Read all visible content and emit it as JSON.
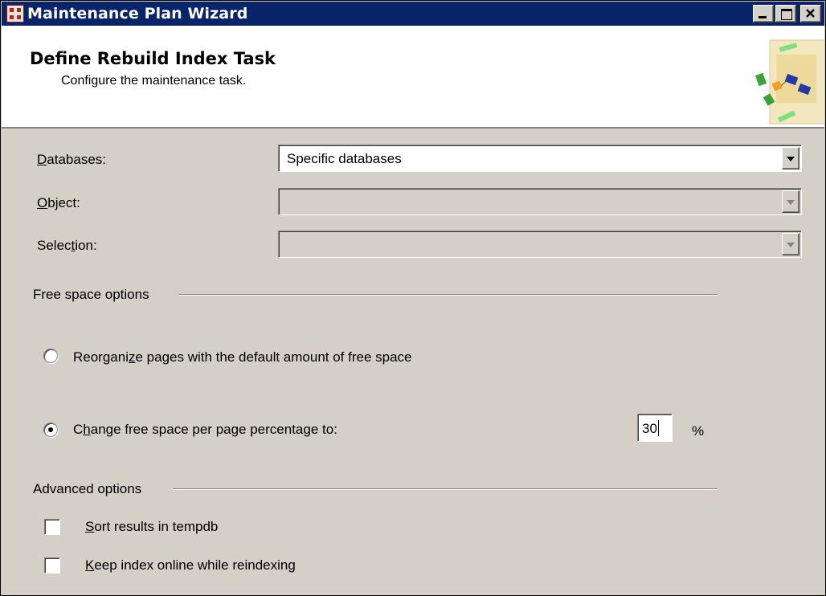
{
  "window": {
    "title": "Maintenance Plan Wizard"
  },
  "header": {
    "title": "Define Rebuild Index Task",
    "subtitle": "Configure the maintenance task."
  },
  "form": {
    "databases": {
      "label_access": "D",
      "label_rest": "atabases:",
      "value": "Specific databases"
    },
    "object": {
      "label_access": "O",
      "label_rest": "bject:",
      "value": ""
    },
    "selection": {
      "label_pre": "Selec",
      "label_access": "t",
      "label_rest": "ion:",
      "value": ""
    }
  },
  "free_space": {
    "group_label": "Free space options",
    "reorganize": {
      "label_pre": "Reorgani",
      "label_access": "z",
      "label_rest": "e pages with the default amount of free space",
      "checked": false
    },
    "change": {
      "label_pre": "C",
      "label_access": "h",
      "label_rest": "ange free space per page percentage to:",
      "checked": true
    },
    "percentage_value": "30",
    "percent_sign": "%"
  },
  "advanced": {
    "group_label": "Advanced options",
    "sort_tempdb": {
      "label_access": "S",
      "label_rest": "ort results in tempdb",
      "checked": false
    },
    "keep_online": {
      "label_access": "K",
      "label_rest": "eep index online while reindexing",
      "checked": false
    }
  }
}
